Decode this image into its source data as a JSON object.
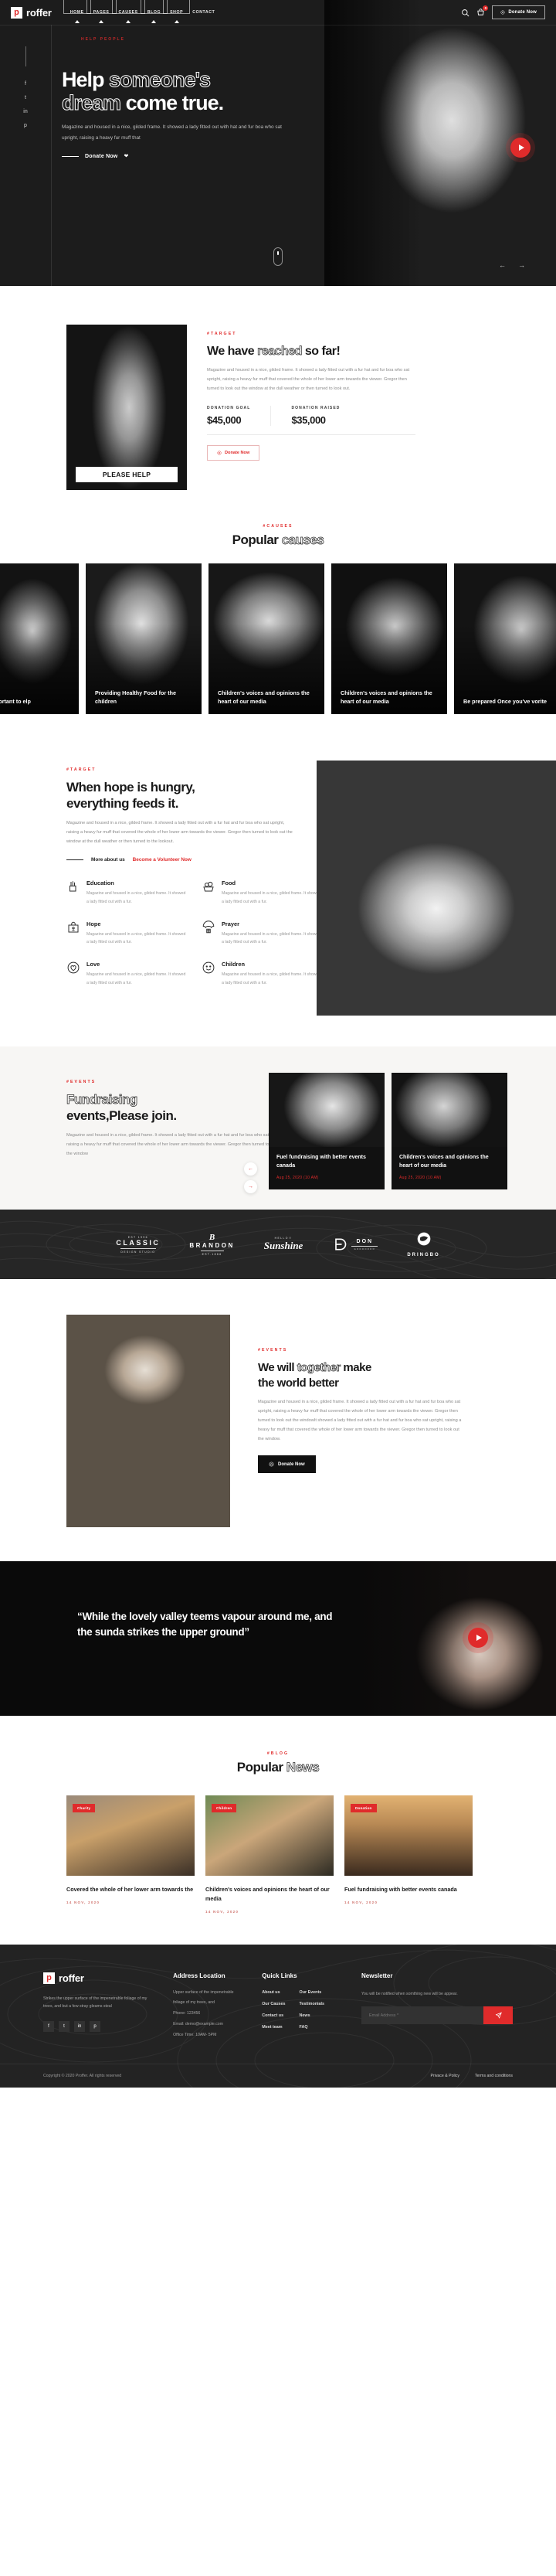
{
  "header": {
    "brand_mark": "p",
    "brand_name": "roffer",
    "nav": [
      {
        "label": "HOME",
        "boxed": true
      },
      {
        "label": "PAGES",
        "boxed": true
      },
      {
        "label": "CAUSES",
        "boxed": true
      },
      {
        "label": "BLOG",
        "boxed": true
      },
      {
        "label": "SHOP",
        "boxed": true
      },
      {
        "label": "CONTACT",
        "boxed": false
      }
    ],
    "search_icon": "search-icon",
    "cart_icon": "cart-icon",
    "cart_count": "0",
    "donate_label": "Donate Now"
  },
  "hero": {
    "eyebrow": "HELP PEOPLE",
    "title_1": "Help",
    "title_2": "someone's",
    "title_3": "dream",
    "title_4": "come true.",
    "paragraph": "Magazine and housed in a nice, gilded frame. It showed a lady fitted out with hat and fur boa who sat upright, raising a heavy fur muff that",
    "cta": "Donate Now",
    "socials": [
      "f",
      "t",
      "in",
      "p"
    ],
    "prev": "←",
    "next": "→"
  },
  "reached": {
    "image_caption": "PLEASE HELP",
    "tag": "#TARGET",
    "title_1": "We have",
    "title_2": "reached",
    "title_3": "so far!",
    "paragraph": "Magazine and housed in a nice, gilded frame. It showed a lady fitted out with a fur hat and fur boa who sat upright, raising a heavy fur muff that covered the whole of her lower arm towards the viewer. Gregor then turned to look out the window at the dull weather or then turned to look out.",
    "stats": [
      {
        "label": "DONATION GOAL",
        "value": "$45,000"
      },
      {
        "label": "DONATION RAISED",
        "value": "$35,000"
      }
    ],
    "button": "Donate Now"
  },
  "causes": {
    "tag": "#CAUSES",
    "title_1": "Popular",
    "title_2": "causes",
    "items": [
      {
        "title": "uncertain\nortant to\nelp"
      },
      {
        "title": "Providing Healthy Food for the children"
      },
      {
        "title": "Children's voices and opinions the heart of our media"
      },
      {
        "title": "Children's voices and opinions the heart of our media"
      },
      {
        "title": "Be prepared Once you've vorite"
      }
    ]
  },
  "hope": {
    "tag": "#TARGET",
    "title_1": "When hope is hungry,",
    "title_2": "everything feeds it.",
    "paragraph": "Magazine and housed in a nice, gilded frame. It showed a lady fitted out with a fur hat and fur boa who sat upright, raising a heavy fur muff that covered the whole of her lower arm towards the viewer. Gregor then turned to look out the window at the dull weather or then turned to the lookout.",
    "link_more": "More about us",
    "link_volunteer": "Become a Volunteer Now",
    "features": [
      {
        "icon": "pencil-cup-icon",
        "title": "Education",
        "text": "Magazine and housed in a nice, gilded frame. It showed a lady fitted out with a fur."
      },
      {
        "icon": "fruit-basket-icon",
        "title": "Food",
        "text": "Magazine and housed in a nice, gilded frame. It showed a lady fitted out with a fur."
      },
      {
        "icon": "donation-box-icon",
        "title": "Hope",
        "text": "Magazine and housed in a nice, gilded frame. It showed a lady fitted out with a fur."
      },
      {
        "icon": "parachute-box-icon",
        "title": "Prayer",
        "text": "Magazine and housed in a nice, gilded frame. It showed a lady fitted out with a fur."
      },
      {
        "icon": "heart-circle-icon",
        "title": "Love",
        "text": "Magazine and housed in a nice, gilded frame. It showed a lady fitted out with a fur."
      },
      {
        "icon": "smiley-face-icon",
        "title": "Children",
        "text": "Magazine and housed in a nice, gilded frame. It showed a lady fitted out with a fur."
      }
    ]
  },
  "events": {
    "tag": "#EVENTS",
    "title_1": "Fundraising",
    "title_2": "events,Please join.",
    "paragraph": "Magazine and housed in a nice, gilded frame. It showed a lady fitted out with a fur hat and fur boa who sat upright, raising a heavy fur muff that covered the whole of her lower arm towards the viewer. Gregor then turned to look out the window",
    "prev": "←",
    "next": "→",
    "cards": [
      {
        "title": "Fuel fundraising with better events canada",
        "date": "Aug 25, 2020 (10 AM)"
      },
      {
        "title": "Children's voices and opinions the heart of our media",
        "date": "Aug 25, 2020 (10 AM)"
      }
    ]
  },
  "logos": [
    {
      "top": "EST 1996",
      "main": "CLASSIC",
      "bottom": "DESIGN STUDIO"
    },
    {
      "top": "B",
      "main": "BRANDON",
      "bottom": "EST.1888"
    },
    {
      "top": "HELLO!!",
      "main": "Sunshine",
      "bottom": ""
    },
    {
      "top": "",
      "main": "DON",
      "bottom": "GOOOOOOO"
    },
    {
      "top": "",
      "main": "DRINGBO",
      "bottom": ""
    }
  ],
  "together": {
    "tag": "#EVENTS",
    "title_1": "We will",
    "title_2": "together",
    "title_3": "make",
    "title_4": "the world better",
    "paragraph": "Magazine and housed in a nice, gilded frame. It showed a lady fitted out with a fur hat and fur boa who sat upright, raising a heavy fur muff that covered the whole of her lower arm towards the viewer. Gregor then turned to look out the windowIt showed a lady fitted out with a fur hat and fur boa who sat upright, raising a heavy fur muff that covered the whole of her lower arm towards the viewer. Gregor then turned to look out the window.",
    "button": "Donate Now"
  },
  "quote": {
    "text": "“While the lovely valley teems vapour around me, and the sunda strikes the upper ground”",
    "play": "play-icon"
  },
  "blog": {
    "tag": "#BLOG",
    "title_1": "Popular",
    "title_2": "News",
    "posts": [
      {
        "category": "Charity",
        "title": "Covered the whole of her lower arm towards the",
        "date": "14 NOV, 2020"
      },
      {
        "category": "Children",
        "title": "Children's voices and opinions the heart of our media",
        "date": "14 NOV, 2020"
      },
      {
        "category": "Donation",
        "title": "Fuel fundraising with better events canada",
        "date": "14 NOV, 2020"
      }
    ]
  },
  "footer": {
    "brand_mark": "p",
    "brand_name": "roffer",
    "about": "Strikes the upper surface of the impenetrable foliage of my trees, and but a few stray gleams steal",
    "socials": [
      "f",
      "t",
      "in",
      "p"
    ],
    "address_heading": "Address Location",
    "address_lines": [
      "Upper surface of the impenetrable",
      "foliage of my trees, and",
      "Phone: 123456",
      "Email: demo@example.com",
      "Office Time: 10AM- 5PM"
    ],
    "links_heading": "Quick Links",
    "links_col1": [
      "About us",
      "Our Causes",
      "Contact us",
      "Meet team"
    ],
    "links_col2": [
      "Our Events",
      "Testimonials",
      "News",
      "FAQ"
    ],
    "newsletter_heading": "Newsletter",
    "newsletter_text": "You will be notified when somthing new will be appear.",
    "newsletter_placeholder": "Email Address *",
    "send_icon": "send-icon",
    "copyright": "Copyright © 2020 Proffer. All rights reserved",
    "legal": [
      "Privace & Policy",
      "Terms and conditions"
    ]
  },
  "colors": {
    "accent": "#e02b2b",
    "dark": "#1a1a1a",
    "footer_bg": "#232323",
    "muted": "#8b8b8b"
  }
}
